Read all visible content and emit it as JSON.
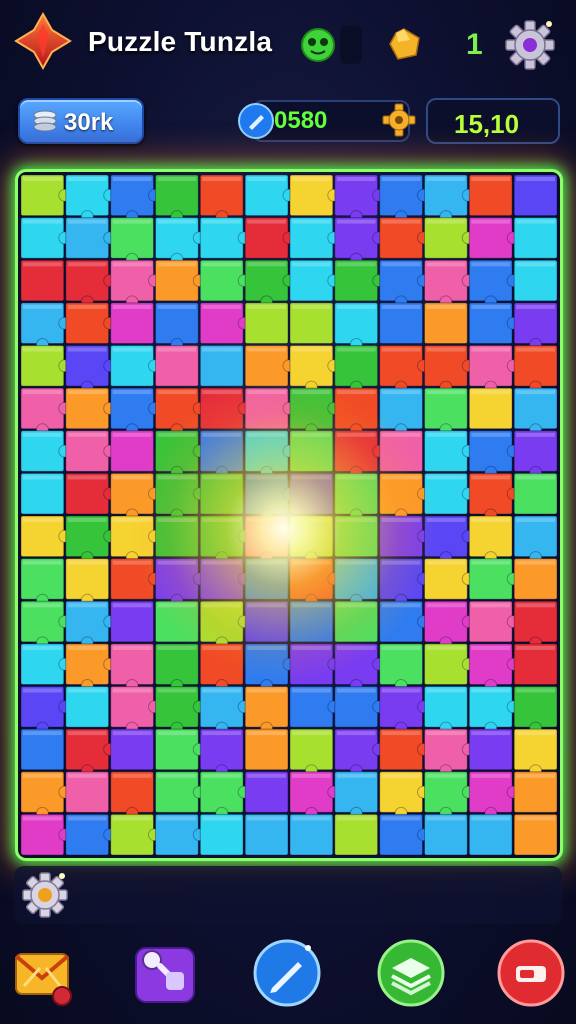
{
  "header": {
    "title": "Puzzle Tunzla",
    "gem_count": "1"
  },
  "stats": {
    "level_label": "30rk",
    "score": "0580",
    "time": "15,10"
  },
  "board": {
    "rows": 16,
    "cols": 12,
    "palette": [
      "#7a3cf0",
      "#2f7cf0",
      "#35b6f0",
      "#2fd6f0",
      "#4ce060",
      "#36c43a",
      "#a8e030",
      "#f5d330",
      "#fb9a28",
      "#f04a26",
      "#e52d3a",
      "#e03cc8",
      "#f060a8",
      "#5a46f5"
    ]
  },
  "icons": {
    "logo": "red-crystal-logo-icon",
    "slime": "green-slime-icon",
    "gem": "gold-gem-icon",
    "settings": "gear-icon",
    "level": "stacked-coins-icon",
    "score": "blue-diamond-icon",
    "coin": "gold-gear-coin-icon",
    "hint": "hint-gear-icon",
    "btn1": "envelope-icon",
    "btn2": "pieces-icon",
    "btn3": "pencil-icon",
    "btn4": "layers-icon",
    "btn5": "ticket-icon"
  },
  "colors": {
    "score_text": "#62ff3a",
    "time_text": "#b9ff3c",
    "board_border": "#3cff52"
  }
}
